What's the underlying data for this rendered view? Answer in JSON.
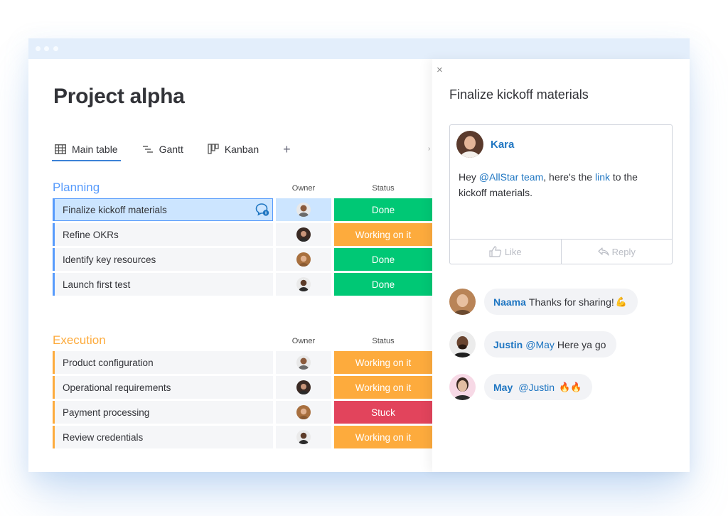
{
  "app": {
    "title": "Project alpha"
  },
  "tabs": [
    {
      "label": "Main table",
      "icon": "table-icon",
      "active": true
    },
    {
      "label": "Gantt",
      "icon": "gantt-icon",
      "active": false
    },
    {
      "label": "Kanban",
      "icon": "kanban-icon",
      "active": false
    }
  ],
  "tabs_add_label": "+",
  "tabs_scroll_label": "›",
  "colors": {
    "accent": "#579bfc",
    "done": "#00c875",
    "working": "#fdab3d",
    "stuck": "#e2445c",
    "link": "#1f76c2"
  },
  "groups": [
    {
      "title": "Planning",
      "color": "#579bfc",
      "owner_header": "Owner",
      "status_header": "Status",
      "rows": [
        {
          "name": "Finalize kickoff materials",
          "owner": "male-avatar-1",
          "status": "Done",
          "status_color": "#00c875",
          "selected": true,
          "has_updates": true
        },
        {
          "name": "Refine OKRs",
          "owner": "female-avatar-1",
          "status": "Working on it",
          "status_color": "#fdab3d",
          "selected": false
        },
        {
          "name": "Identify key resources",
          "owner": "female-avatar-2",
          "status": "Done",
          "status_color": "#00c875",
          "selected": false
        },
        {
          "name": "Launch first test",
          "owner": "male-avatar-2",
          "status": "Done",
          "status_color": "#00c875",
          "selected": false
        }
      ]
    },
    {
      "title": "Execution",
      "color": "#fdab3d",
      "owner_header": "Owner",
      "status_header": "Status",
      "rows": [
        {
          "name": "Product configuration",
          "owner": "male-avatar-1",
          "status": "Working on it",
          "status_color": "#fdab3d"
        },
        {
          "name": "Operational requirements",
          "owner": "female-avatar-1",
          "status": "Working on it",
          "status_color": "#fdab3d"
        },
        {
          "name": "Payment processing",
          "owner": "female-avatar-2",
          "status": "Stuck",
          "status_color": "#e2445c"
        },
        {
          "name": "Review credentials",
          "owner": "male-avatar-2",
          "status": "Working on it",
          "status_color": "#fdab3d"
        }
      ]
    }
  ],
  "panel": {
    "close_label": "×",
    "title": "Finalize kickoff materials",
    "post": {
      "author": "Kara",
      "text_prefix": "Hey ",
      "mention": "@AllStar team",
      "text_middle": ", here's the ",
      "link_text": "link",
      "text_suffix": " to the kickoff materials.",
      "like_label": "Like",
      "reply_label": "Reply"
    },
    "replies": [
      {
        "author": "Naama",
        "mention": "",
        "text": "Thanks for sharing!",
        "emoji": "💪"
      },
      {
        "author": "Justin",
        "mention": "@May",
        "text": "Here ya go",
        "emoji": ""
      },
      {
        "author": "May",
        "mention": "@Justin",
        "text": "",
        "emoji": "🔥🔥"
      }
    ]
  }
}
